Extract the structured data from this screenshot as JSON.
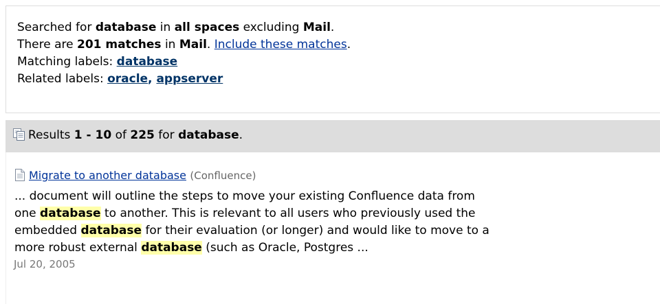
{
  "search_info": {
    "line1": {
      "prefix": "Searched for ",
      "query": "database",
      "mid": " in ",
      "scope": "all spaces",
      "excluding_text": " excluding ",
      "excluded_space": "Mail",
      "suffix": "."
    },
    "line2": {
      "prefix": "There are ",
      "match_count": "201 matches",
      "mid": " in ",
      "space": "Mail",
      "sep": ". ",
      "include_link": "Include these matches",
      "suffix": "."
    },
    "matching_labels": {
      "label": "Matching labels: ",
      "items": [
        "database"
      ]
    },
    "related_labels": {
      "label": "Related labels: ",
      "items": [
        "oracle",
        "appserver"
      ],
      "separator": ", "
    }
  },
  "results_header": {
    "icon": "documents-icon",
    "prefix": "Results ",
    "range": "1 - 10",
    "of_text": " of ",
    "total": "225",
    "for_text": " for ",
    "query": "database",
    "suffix": "."
  },
  "results": [
    {
      "icon": "page-icon",
      "title": "Migrate to another database",
      "space": "(Confluence)",
      "excerpt": {
        "line1": "... document will outline the steps to move your existing Confluence data from",
        "line2_pre": "one ",
        "line2_hl": "database",
        "line2_post": " to another. This is relevant to all users who previously used the",
        "line3_pre": "embedded ",
        "line3_hl": "database",
        "line3_post": " for their evaluation (or longer) and would like to move to a",
        "line4_pre": "more robust external ",
        "line4_hl": "database",
        "line4_post": " (such as Oracle, Postgres ..."
      },
      "date": "Jul 20, 2005"
    }
  ],
  "colors": {
    "link": "#003399",
    "label_link": "#003366",
    "header_bg": "#dddddd",
    "highlight": "#ffffaa"
  }
}
